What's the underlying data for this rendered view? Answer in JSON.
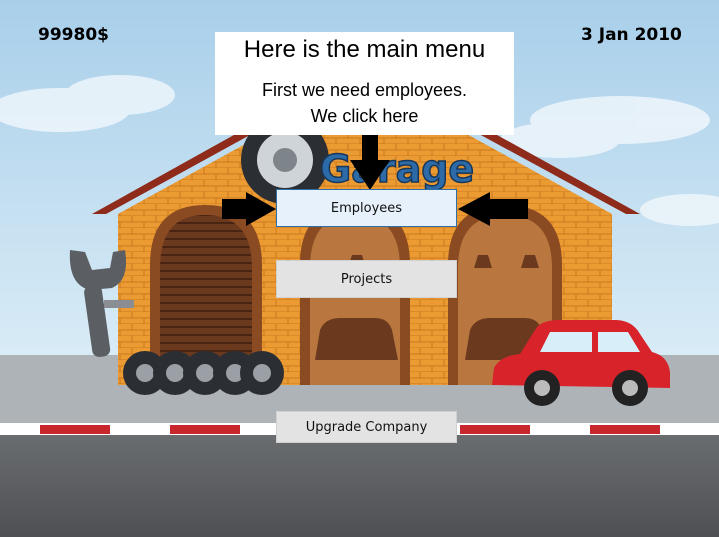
{
  "hud": {
    "money": "99980$",
    "date": "3 Jan 2010"
  },
  "tutorial": {
    "title": "Here is the main menu",
    "line1": "First we need employees.",
    "line2": "We click here"
  },
  "sign_text": "Garage",
  "menu": {
    "employees_label": "Employees",
    "projects_label": "Projects",
    "upgrade_label": "Upgrade Company"
  },
  "colors": {
    "sky": "#b9d9ee",
    "brick": "#e8952e",
    "roof": "#8e2b1a",
    "car": "#d9232a",
    "road": "#5e6063",
    "button_highlight_border": "#2f6fa8"
  },
  "icons": [
    "wrench-icon",
    "tire-stack-icon",
    "car-icon",
    "arrow-down-icon",
    "arrow-right-icon",
    "arrow-left-icon"
  ]
}
